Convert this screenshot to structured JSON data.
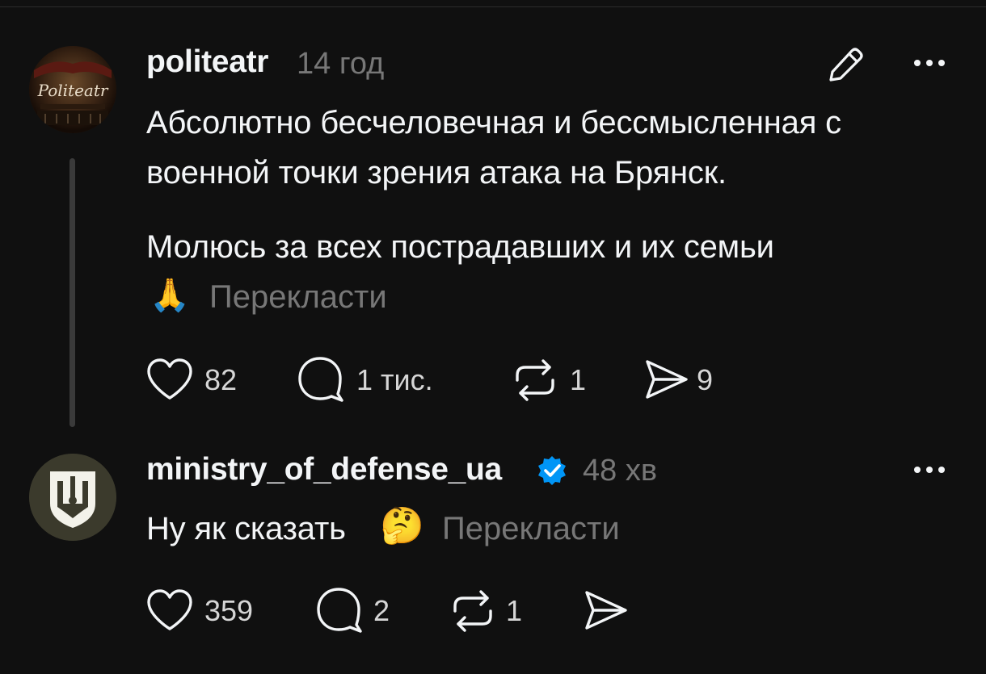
{
  "posts": [
    {
      "username": "politeatr",
      "time": "14 год",
      "avatar_text": "Politeatr",
      "body_lines": [
        "Абсолютно бесчеловечная и бессмысленная с",
        "военной точки зрения атака на Брянск."
      ],
      "body_line3": "Молюсь за всех пострадавших и их семьи",
      "emoji": "🙏",
      "translate_label": "Перекласти",
      "likes": "82",
      "comments": "1 тис.",
      "reposts": "1",
      "shares": "9"
    },
    {
      "username": "ministry_of_defense_ua",
      "time": "48 хв",
      "body": "Ну як сказать",
      "emoji": "🤔",
      "translate_label": "Перекласти",
      "likes": "359",
      "comments": "2",
      "reposts": "1",
      "shares": ""
    }
  ],
  "icons": {
    "edit": "pencil-icon",
    "more": "more-icon",
    "like": "heart-icon",
    "comment": "comment-icon",
    "repost": "repost-icon",
    "share": "share-icon",
    "verified": "verified-badge-icon"
  },
  "colors": {
    "background": "#101010",
    "text": "#f3f5f7",
    "muted": "#777777",
    "verified": "#0095f6"
  }
}
